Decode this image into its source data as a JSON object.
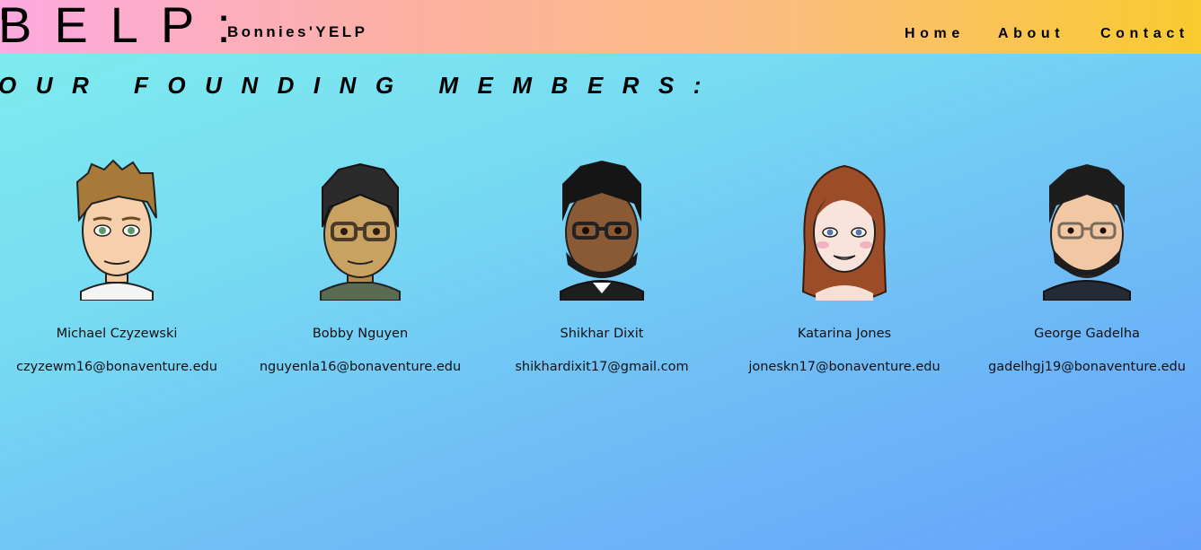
{
  "header": {
    "logo": "BELP:",
    "site_name": "Bonnies'YELP",
    "nav": [
      {
        "label": "Home"
      },
      {
        "label": "About"
      },
      {
        "label": "Contact"
      }
    ],
    "gradient": [
      "#fcaae0",
      "#f8cb2e"
    ]
  },
  "section_title": "OUR FOUNDING MEMBERS:",
  "members": [
    {
      "name": "Michael Czyzewski",
      "email": "czyzewm16@bonaventure.edu",
      "avatar_icon": "avatar-blond-man-icon"
    },
    {
      "name": "Bobby Nguyen",
      "email": "nguyenla16@bonaventure.edu",
      "avatar_icon": "avatar-man-glasses-icon"
    },
    {
      "name": "Shikhar Dixit",
      "email": "shikhardixit17@gmail.com",
      "avatar_icon": "avatar-bearded-man-glasses-icon"
    },
    {
      "name": "Katarina Jones",
      "email": "joneskn17@bonaventure.edu",
      "avatar_icon": "avatar-woman-icon"
    },
    {
      "name": "George Gadelha",
      "email": "gadelhgj19@bonaventure.edu",
      "avatar_icon": "avatar-bearded-man-icon"
    }
  ],
  "background_gradient": [
    "#7eeeed",
    "#65a3fb"
  ]
}
